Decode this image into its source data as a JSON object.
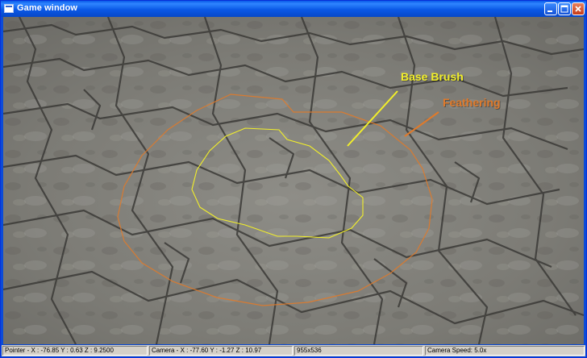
{
  "window": {
    "title": "Game window",
    "buttons": {
      "minimize": "minimize-icon",
      "maximize": "maximize-icon",
      "close": "close-icon"
    }
  },
  "scene": {
    "annotations": {
      "base_brush": "Base Brush",
      "feathering": "Feathering"
    },
    "colors": {
      "base_brush": "#f2ef2a",
      "feathering": "#e07a2a",
      "tile_light": "#9b9a94",
      "tile_dark": "#6c6b66"
    }
  },
  "status": {
    "pointer": "Pointer - X : -76.85  Y : 0.63  Z : 9.2500",
    "camera": "Camera - X : -77.60  Y : -1.27  Z : 10.97",
    "resolution": "955x536",
    "camera_speed": "Camera Speed: 5.0x"
  }
}
